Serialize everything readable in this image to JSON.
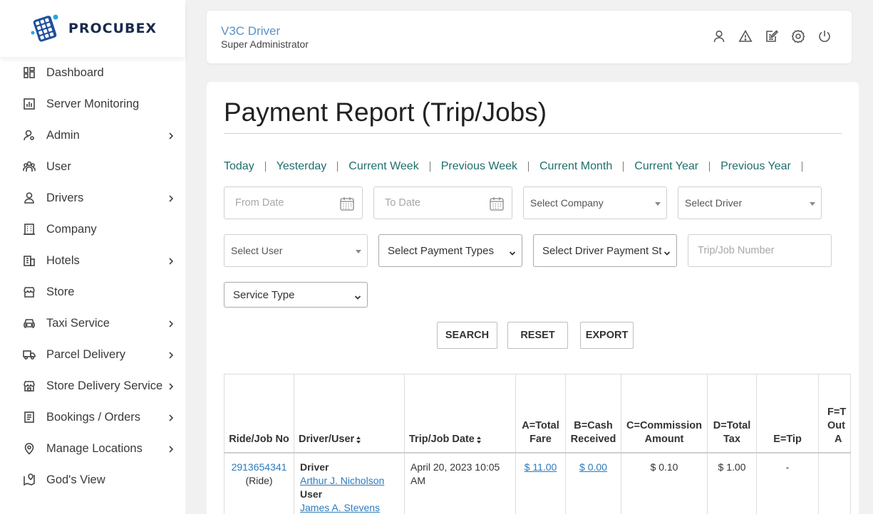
{
  "brand": {
    "name": "PROCUBEX"
  },
  "sidebar": {
    "items": [
      {
        "label": "Dashboard",
        "icon": "dashboard-icon",
        "chevron": false
      },
      {
        "label": "Server Monitoring",
        "icon": "chart-icon",
        "chevron": false
      },
      {
        "label": "Admin",
        "icon": "admin-icon",
        "chevron": true
      },
      {
        "label": "User",
        "icon": "users-icon",
        "chevron": false
      },
      {
        "label": "Drivers",
        "icon": "driver-icon",
        "chevron": true
      },
      {
        "label": "Company",
        "icon": "building-icon",
        "chevron": false
      },
      {
        "label": "Hotels",
        "icon": "hotel-icon",
        "chevron": true
      },
      {
        "label": "Store",
        "icon": "store-icon",
        "chevron": false
      },
      {
        "label": "Taxi Service",
        "icon": "car-icon",
        "chevron": true
      },
      {
        "label": "Parcel Delivery",
        "icon": "truck-icon",
        "chevron": true
      },
      {
        "label": "Store Delivery Service",
        "icon": "store-delivery-icon",
        "chevron": true
      },
      {
        "label": "Bookings / Orders",
        "icon": "bookings-icon",
        "chevron": true
      },
      {
        "label": "Manage Locations",
        "icon": "location-icon",
        "chevron": true
      },
      {
        "label": "God's View",
        "icon": "map-view-icon",
        "chevron": false
      }
    ]
  },
  "header": {
    "title": "V3C Driver",
    "subtitle": "Super Administrator",
    "icons": [
      "profile-icon",
      "alert-icon",
      "edit-icon",
      "settings-icon",
      "power-icon"
    ]
  },
  "page": {
    "title": "Payment Report (Trip/Jobs)",
    "quick_filters": [
      "Today",
      "Yesterday",
      "Current Week",
      "Previous Week",
      "Current Month",
      "Current Year",
      "Previous Year"
    ],
    "filters": {
      "from_date": "From Date",
      "to_date": "To Date",
      "company": "Select Company",
      "driver": "Select Driver",
      "user": "Select User",
      "payment_types": "Select Payment Types",
      "driver_payment_status": "Select Driver Payment St",
      "trip_number": "Trip/Job Number",
      "service_type": "Service Type"
    },
    "buttons": {
      "search": "SEARCH",
      "reset": "RESET",
      "export": "EXPORT"
    }
  },
  "table": {
    "headers": {
      "ride_no": "Ride/Job No",
      "driver_user": "Driver/User",
      "trip_date": "Trip/Job Date",
      "total_fare_1": "A=Total",
      "total_fare_2": "Fare",
      "cash_1": "B=Cash",
      "cash_2": "Received",
      "commission_1": "C=Commission",
      "commission_2": "Amount",
      "tax_1": "D=Total",
      "tax_2": "Tax",
      "tip": "E=Tip",
      "outstanding_1": "F=T",
      "outstanding_2": "Out",
      "outstanding_3": "A"
    },
    "rows": [
      {
        "ride_no": "2913654341",
        "ride_type": "(Ride)",
        "driver_label": "Driver",
        "driver_name": "Arthur J. Nicholson",
        "user_label": "User",
        "user_name": "James A. Stevens",
        "date": "April 20, 2023 10:05 AM",
        "total_fare": "$ 11.00",
        "cash": "$ 0.00",
        "commission": "$ 0.10",
        "tax": "$ 1.00",
        "tip": "-",
        "outstanding": ""
      }
    ]
  }
}
